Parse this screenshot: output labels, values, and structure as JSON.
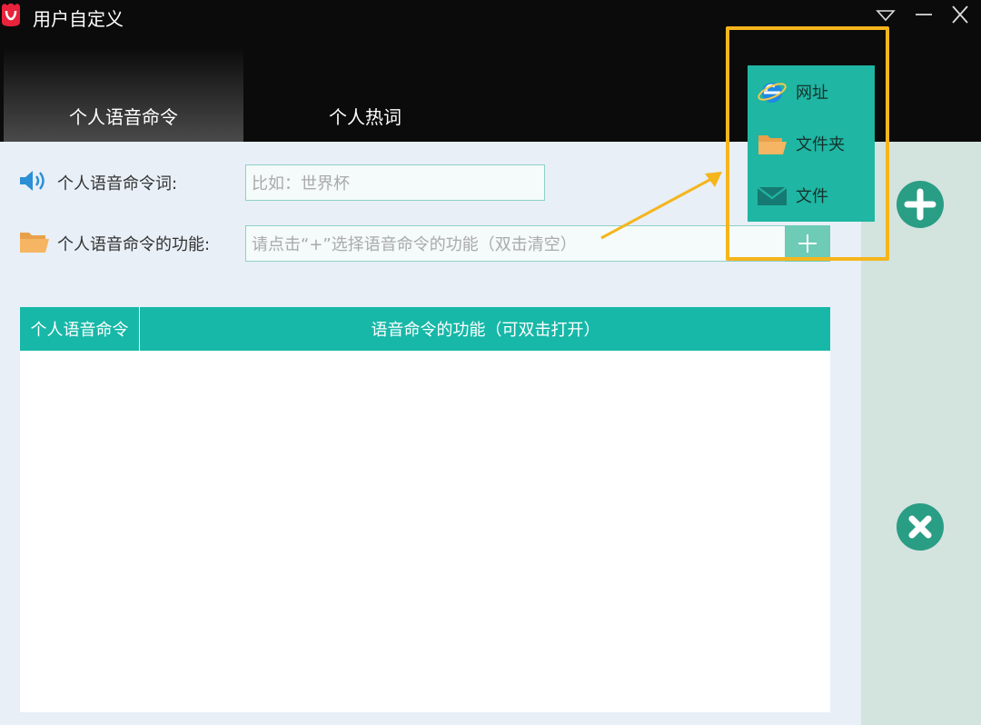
{
  "window": {
    "title": "用户自定义",
    "controls": [
      "dropdown-triangle-icon",
      "minimize-icon",
      "close-icon"
    ]
  },
  "tabs": [
    {
      "label": "个人语音命令",
      "active": true
    },
    {
      "label": "个人热词",
      "active": false
    }
  ],
  "form": {
    "command_word_label": "个人语音命令词:",
    "command_word_placeholder": "比如：世界杯",
    "function_label": "个人语音命令的功能:",
    "function_placeholder": "请点击“+”选择语音命令的功能（双击清空）"
  },
  "table": {
    "columns": [
      "个人语音命令",
      "语音命令的功能（可双击打开）"
    ],
    "rows": []
  },
  "dropdown_menu": {
    "items": [
      {
        "label": "网址",
        "icon": "ie-browser-icon"
      },
      {
        "label": "文件夹",
        "icon": "folder-icon"
      },
      {
        "label": "文件",
        "icon": "envelope-icon"
      }
    ]
  },
  "colors": {
    "accent": "#17b8a8",
    "highlight": "#f5b51c",
    "action": "#2a9d85"
  }
}
